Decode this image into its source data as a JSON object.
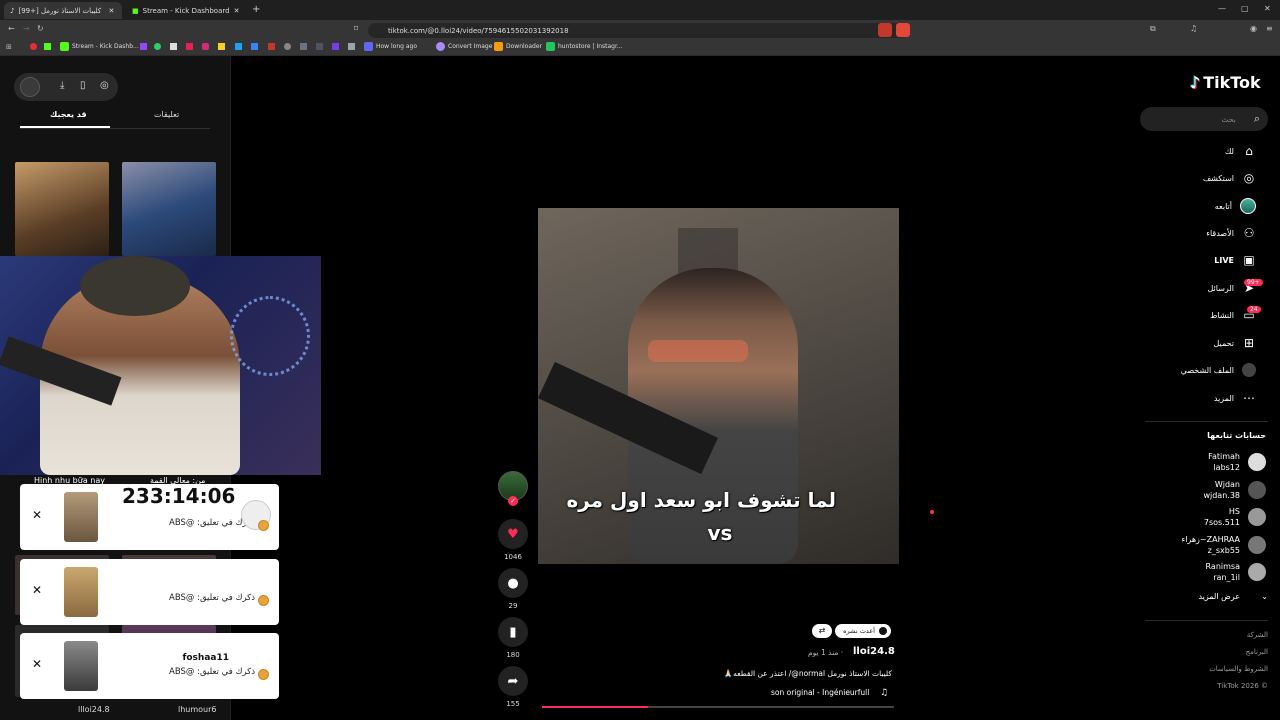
{
  "browser": {
    "tabs": [
      {
        "label": "[99+] كليبات الاستاذ نورمل",
        "active": true
      },
      {
        "label": "Stream - Kick Dashboard",
        "active": false
      }
    ],
    "new_tab": "+",
    "url": "tiktok.com/@0.lloi24/video/7594615502031392018",
    "bookmarks": [
      "Stream - Kick Dashb...",
      "How long ago",
      "Convert Image",
      "Downloader",
      "huntostore | Instagr..."
    ]
  },
  "left": {
    "tab_comments": "تعليقات",
    "tab_liked": "قد يعجبك",
    "bottom_users": [
      "llloi24.8",
      "lhumour6"
    ],
    "overlay_text_1": "Hinh nhu bữa nay",
    "overlay_text_2": "من: معالي القمة"
  },
  "notifications": [
    {
      "timer": "233:14:06",
      "name": "",
      "text": "ذكرك في تعليق: @ABS"
    },
    {
      "name": "",
      "text": "ذكرك في تعليق: @ABS"
    },
    {
      "name": "foshaa11",
      "text": "ذكرك في تعليق: @ABS"
    }
  ],
  "video": {
    "caption_line1": "لما تشوف ابو سعد اول مره",
    "caption_line2": "vs",
    "likes": "1046",
    "comments": "29",
    "saves": "180",
    "shares": "155",
    "tag_label": "أعدت نشره",
    "author": "lloi24.8",
    "posted": "· منذ 1 يوم",
    "description": "كليبات الاستاذ نورمل normal@/ اعتذر عن القطعه🙏🏻",
    "sound": "son original - Ingénieurfull",
    "progress": 0.3
  },
  "nav": {
    "logo": "TikTok",
    "search_placeholder": "بحث",
    "items": [
      {
        "label": "لك",
        "icon": "home-icon"
      },
      {
        "label": "استكشف",
        "icon": "compass-icon"
      },
      {
        "label": "أتابعه",
        "icon": "following-icon"
      },
      {
        "label": "الأصدقاء",
        "icon": "friends-icon"
      },
      {
        "label": "LIVE",
        "icon": "live-icon"
      },
      {
        "label": "الرسائل",
        "icon": "inbox-icon",
        "badge": "99+"
      },
      {
        "label": "النشاط",
        "icon": "activity-icon",
        "badge": "24"
      },
      {
        "label": "تحميل",
        "icon": "upload-icon"
      },
      {
        "label": "الملف الشخصي",
        "icon": "profile-icon"
      },
      {
        "label": "المزيد",
        "icon": "more-icon"
      }
    ],
    "following_title": "حسابات تتابعها",
    "following": [
      {
        "name": "Fatimah",
        "handle": "labs12"
      },
      {
        "name": "Wjdan",
        "handle": "wjdan.38"
      },
      {
        "name": "HS",
        "handle": "7sos.511"
      },
      {
        "name": "ZAHRAA~زهراء",
        "handle": "z_sxb55"
      },
      {
        "name": "Ranimsa",
        "handle": "ran_1il"
      }
    ],
    "show_more": "عرض المزيد",
    "footer": [
      "الشركة",
      "البرنامج",
      "الشروط والسياسات",
      "TikTok 2026 ©"
    ]
  }
}
